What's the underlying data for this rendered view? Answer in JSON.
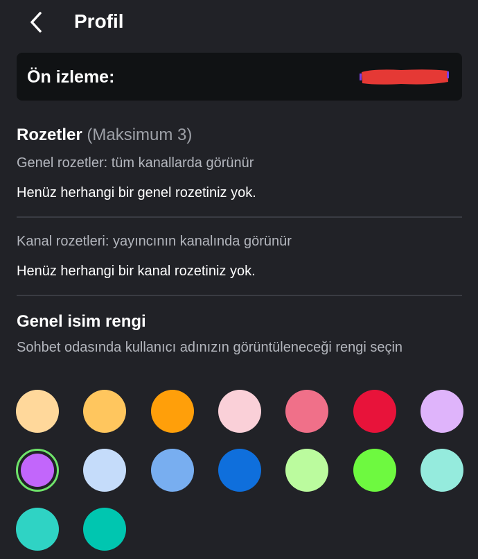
{
  "header": {
    "title": "Profil",
    "back_icon": "chevron-left-icon"
  },
  "preview": {
    "label": "Ön izleme:",
    "redaction_color": "#e53935"
  },
  "badges": {
    "title": "Rozetler",
    "title_suffix": "(Maksimum 3)",
    "global_label": "Genel rozetler: tüm kanallarda görünür",
    "global_empty": "Henüz herhangi bir genel rozetiniz yok.",
    "channel_label": "Kanal rozetleri: yayıncının kanalında görünür",
    "channel_empty": "Henüz herhangi bir kanal rozetiniz yok."
  },
  "name_color": {
    "title": "Genel isim rengi",
    "description": "Sohbet odasında kullanıcı adınızın görüntüleneceği rengi seçin",
    "selected_index": 7,
    "selected_ring_color": "#6fe36a",
    "colors": [
      "#ffd89b",
      "#ffc65e",
      "#ff9f0a",
      "#fad0d8",
      "#f07089",
      "#e8133a",
      "#dfb4fb",
      "#c266fb",
      "#c5dcfa",
      "#78aef0",
      "#0f6fdc",
      "#bbfb9e",
      "#6ef940",
      "#95ebdd",
      "#2fd3c4",
      "#00c6b0"
    ]
  }
}
